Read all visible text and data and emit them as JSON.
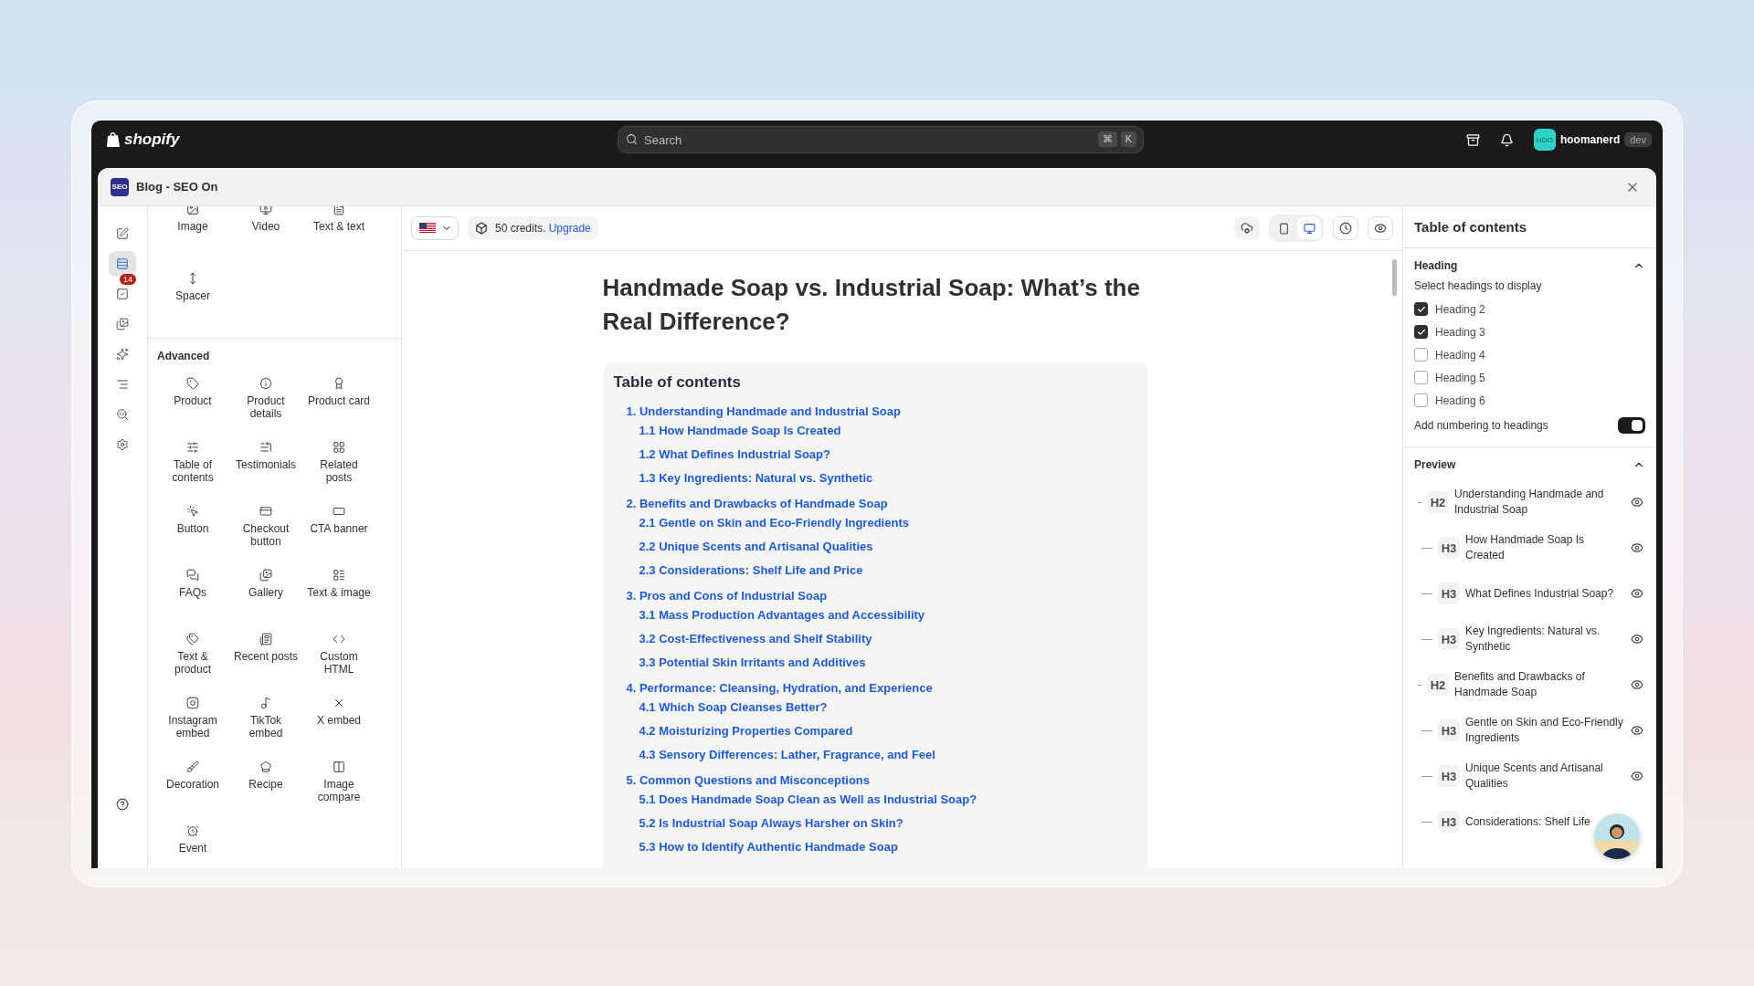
{
  "topbar": {
    "brand": "shopify",
    "search": {
      "placeholder": "Search",
      "keys": [
        "⌘",
        "K"
      ]
    },
    "user": {
      "initials": "HOO",
      "name": "hoomanerd",
      "badge": "dev"
    }
  },
  "app": {
    "logo": "SEO",
    "title": "Blog - SEO On"
  },
  "rail": [
    {
      "selected": false
    },
    {
      "selected": true
    },
    {
      "selected": false,
      "badge": "14"
    },
    {
      "selected": false
    },
    {
      "selected": false
    },
    {
      "selected": false
    },
    {
      "selected": false
    },
    {
      "selected": false
    }
  ],
  "blocks": {
    "basic": [
      "Image",
      "Video",
      "Text & text",
      "Spacer"
    ],
    "advanced_title": "Advanced",
    "advanced": [
      "Product",
      "Product details",
      "Product card",
      "Table of contents",
      "Testimonials",
      "Related posts",
      "Button",
      "Checkout button",
      "CTA banner",
      "FAQs",
      "Gallery",
      "Text & image",
      "Text & product",
      "Recent posts",
      "Custom HTML",
      "Instagram embed",
      "TikTok embed",
      "X embed",
      "Decoration",
      "Recipe",
      "Image compare",
      "Event"
    ]
  },
  "toolbar": {
    "credits": "50 credits.",
    "upgrade": "Upgrade",
    "devices": [
      {
        "selected": false
      },
      {
        "selected": true
      }
    ]
  },
  "article": {
    "title": "Handmade Soap vs. Industrial Soap: What’s the Real Difference?",
    "toc": {
      "title": "Table of contents",
      "sections": [
        {
          "label": "1. Understanding Handmade and Industrial Soap",
          "children": [
            {
              "label": "1.1 How Handmade Soap Is Created"
            },
            {
              "label": "1.2 What Defines Industrial Soap?"
            },
            {
              "label": "1.3 Key Ingredients: Natural vs. Synthetic"
            }
          ]
        },
        {
          "label": "2. Benefits and Drawbacks of Handmade Soap",
          "children": [
            {
              "label": "2.1 Gentle on Skin and Eco-Friendly Ingredients"
            },
            {
              "label": "2.2 Unique Scents and Artisanal Qualities"
            },
            {
              "label": "2.3 Considerations: Shelf Life and Price"
            }
          ]
        },
        {
          "label": "3. Pros and Cons of Industrial Soap",
          "children": [
            {
              "label": "3.1 Mass Production Advantages and Accessibility"
            },
            {
              "label": "3.2 Cost-Effectiveness and Shelf Stability"
            },
            {
              "label": "3.3 Potential Skin Irritants and Additives"
            }
          ]
        },
        {
          "label": "4. Performance: Cleansing, Hydration, and Experience",
          "children": [
            {
              "label": "4.1 Which Soap Cleanses Better?"
            },
            {
              "label": "4.2 Moisturizing Properties Compared"
            },
            {
              "label": "4.3 Sensory Differences: Lather, Fragrance, and Feel"
            }
          ]
        },
        {
          "label": "5. Common Questions and Misconceptions",
          "children": [
            {
              "label": "5.1 Does Handmade Soap Clean as Well as Industrial Soap?"
            },
            {
              "label": "5.2 Is Industrial Soap Always Harsher on Skin?"
            },
            {
              "label": "5.3 How to Identify Authentic Handmade Soap"
            }
          ]
        }
      ]
    }
  },
  "settings": {
    "title": "Table of contents",
    "heading": {
      "title": "Heading",
      "expanded": true,
      "hint": "Select headings to display",
      "levels": [
        {
          "label": "Heading 2",
          "checked": true
        },
        {
          "label": "Heading 3",
          "checked": true
        },
        {
          "label": "Heading 4",
          "checked": false
        },
        {
          "label": "Heading 5",
          "checked": false
        },
        {
          "label": "Heading 6",
          "checked": false
        }
      ],
      "numbering": {
        "label": "Add numbering to headings",
        "on": true
      }
    },
    "preview": {
      "title": "Preview",
      "expanded": true,
      "items": [
        {
          "kind": "h2",
          "tag": "H2",
          "text": "Understanding Handmade and Industrial Soap",
          "eye": true
        },
        {
          "kind": "h3",
          "tag": "H3",
          "text": "How Handmade Soap Is Created",
          "eye": true
        },
        {
          "kind": "h3",
          "tag": "H3",
          "text": "What Defines Industrial Soap?",
          "eye": true
        },
        {
          "kind": "h3",
          "tag": "H3",
          "text": "Key Ingredients: Natural vs. Synthetic",
          "eye": true
        },
        {
          "kind": "h2",
          "tag": "H2",
          "text": "Benefits and Drawbacks of Handmade Soap",
          "eye": true
        },
        {
          "kind": "h3",
          "tag": "H3",
          "text": "Gentle on Skin and Eco-Friendly Ingredients",
          "eye": true
        },
        {
          "kind": "h3",
          "tag": "H3",
          "text": "Unique Scents and Artisanal Qualities",
          "eye": true
        },
        {
          "kind": "h3",
          "tag": "H3",
          "text": "Considerations: Shelf Life",
          "eye": false
        }
      ]
    }
  }
}
